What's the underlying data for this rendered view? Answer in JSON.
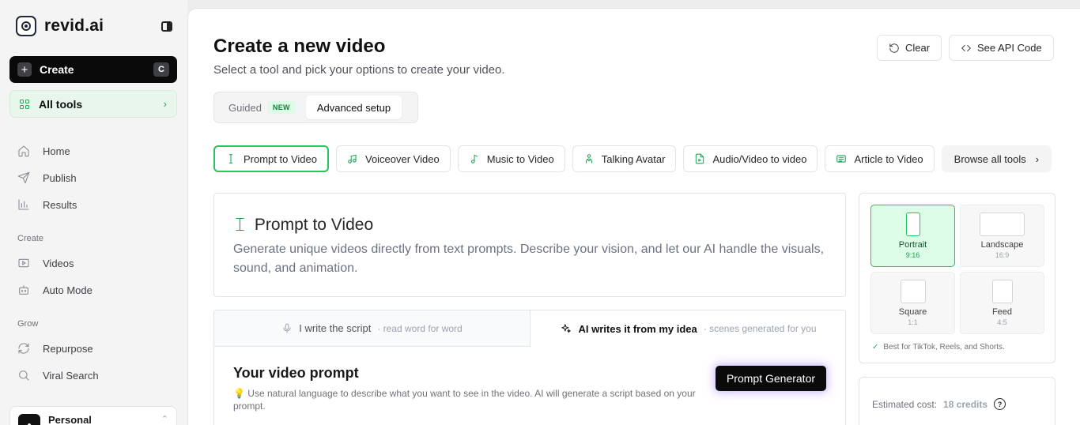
{
  "app": {
    "name": "revid.ai"
  },
  "sidebar": {
    "create_label": "Create",
    "create_shortcut": "C",
    "all_tools_label": "All tools",
    "main_items": [
      {
        "label": "Home",
        "icon": "home-icon"
      },
      {
        "label": "Publish",
        "icon": "send-icon"
      },
      {
        "label": "Results",
        "icon": "bar-chart-icon"
      }
    ],
    "create_section": "Create",
    "create_items": [
      {
        "label": "Videos",
        "icon": "video-icon"
      },
      {
        "label": "Auto Mode",
        "icon": "robot-icon"
      }
    ],
    "grow_section": "Grow",
    "grow_items": [
      {
        "label": "Repurpose",
        "icon": "refresh-icon"
      },
      {
        "label": "Viral Search",
        "icon": "search-icon"
      }
    ],
    "profile_name": "Personal"
  },
  "header": {
    "title": "Create a new video",
    "subtitle": "Select a tool and pick your options to create your video.",
    "clear_label": "Clear",
    "api_label": "See API Code"
  },
  "modes": {
    "guided": "Guided",
    "guided_badge": "NEW",
    "advanced": "Advanced setup",
    "selected": "Advanced setup"
  },
  "tools": [
    {
      "label": "Prompt to Video",
      "icon": "text-cursor-icon",
      "active": true
    },
    {
      "label": "Voiceover Video",
      "icon": "voiceover-icon",
      "active": false
    },
    {
      "label": "Music to Video",
      "icon": "music-note-icon",
      "active": false
    },
    {
      "label": "Talking Avatar",
      "icon": "avatar-icon",
      "active": false
    },
    {
      "label": "Audio/Video to video",
      "icon": "file-audio-icon",
      "active": false
    },
    {
      "label": "Article to Video",
      "icon": "article-icon",
      "active": false
    }
  ],
  "browse_label": "Browse all tools",
  "tool_detail": {
    "title": "Prompt to Video",
    "description": "Generate unique videos directly from text prompts. Describe your vision, and let our AI handle the visuals, sound, and animation."
  },
  "script_tabs": {
    "manual_label": "I write the script",
    "manual_hint": "· read word for word",
    "ai_label": "AI writes it from my idea",
    "ai_hint": "· scenes generated for you",
    "selected": "AI writes it from my idea"
  },
  "prompt": {
    "title": "Your video prompt",
    "hint": "💡 Use natural language to describe what you want to see in the video. AI will generate a script based on your prompt.",
    "generator_label": "Prompt Generator"
  },
  "aspect": {
    "options": [
      {
        "label": "Portrait",
        "ratio": "9:16",
        "selected": true
      },
      {
        "label": "Landscape",
        "ratio": "16:9",
        "selected": false
      },
      {
        "label": "Square",
        "ratio": "1:1",
        "selected": false
      },
      {
        "label": "Feed",
        "ratio": "4:5",
        "selected": false
      }
    ],
    "note": "Best for TikTok, Reels, and Shorts."
  },
  "cost": {
    "label": "Estimated cost:",
    "value": "18 credits"
  },
  "colors": {
    "accent": "#22c55e",
    "accent_bg": "#dcfce7",
    "dark": "#0a0a0a"
  }
}
